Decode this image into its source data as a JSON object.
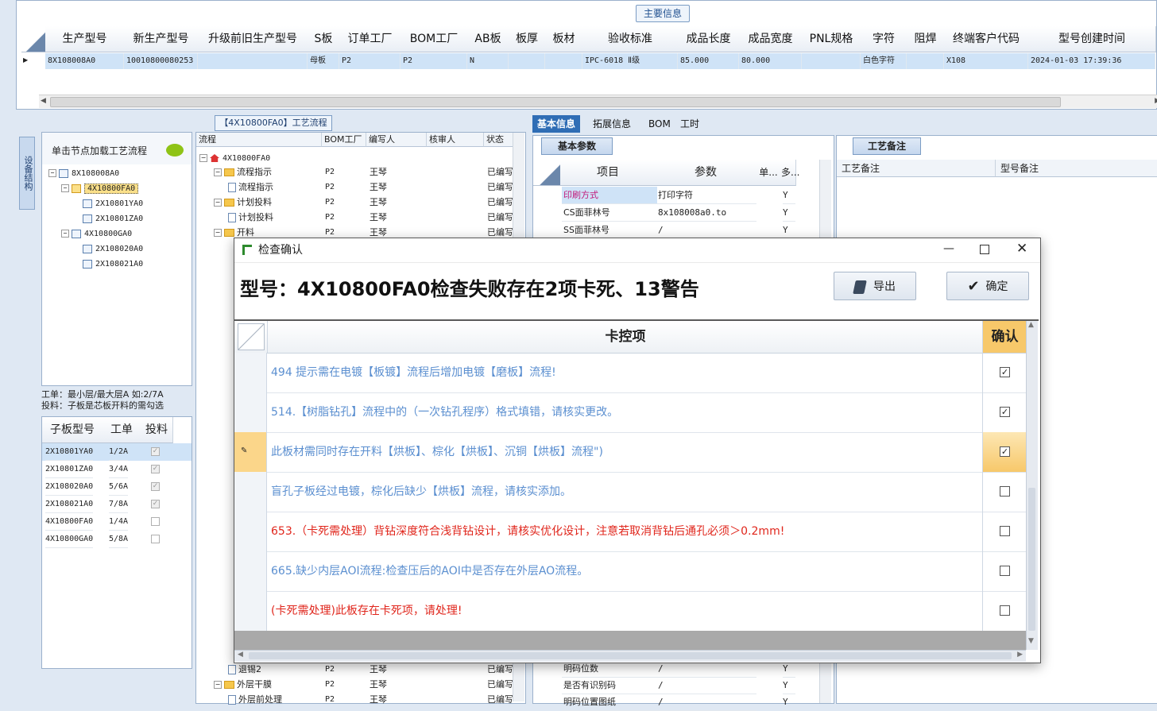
{
  "top": {
    "tab_label": "主要信息",
    "columns": [
      "生产型号",
      "新生产型号",
      "升级前旧生产型号",
      "S板",
      "订单工厂",
      "BOM工厂",
      "AB板",
      "板厚",
      "板材",
      "验收标准",
      "成品长度",
      "成品宽度",
      "PNL规格",
      "字符",
      "阻焊",
      "终端客户代码",
      "型号创建时间"
    ],
    "row": [
      "8X108008A0",
      "10010800080253",
      "",
      "母板",
      "P2",
      "P2",
      "N",
      "",
      "",
      "IPC-6018 Ⅱ级",
      "85.000",
      "80.000",
      "",
      "白色字符",
      "",
      "X108",
      "2024-01-03 17:39:36"
    ]
  },
  "left": {
    "vtab_label": "设备结构",
    "tree_hint": "单击节点加载工艺流程",
    "tree": [
      {
        "label": "8X108008A0",
        "level": 0
      },
      {
        "label": "4X10800FA0",
        "level": 1,
        "selected": true
      },
      {
        "label": "2X10801YA0",
        "level": 2
      },
      {
        "label": "2X10801ZA0",
        "level": 2
      },
      {
        "label": "4X10800GA0",
        "level": 1
      },
      {
        "label": "2X108020A0",
        "level": 2
      },
      {
        "label": "2X108021A0",
        "level": 2
      }
    ],
    "note_line1": "工单：最小层/最大层A 如:2/7A",
    "note_line2": "投料：子板是芯板开料的需勾选",
    "sub_columns": [
      "子板型号",
      "工单",
      "投料"
    ],
    "sub_rows": [
      {
        "model": "2X10801YA0",
        "order": "1/2A",
        "checked": true
      },
      {
        "model": "2X10801ZA0",
        "order": "3/4A",
        "checked": true
      },
      {
        "model": "2X108020A0",
        "order": "5/6A",
        "checked": true
      },
      {
        "model": "2X108021A0",
        "order": "7/8A",
        "checked": true
      },
      {
        "model": "4X10800FA0",
        "order": "1/4A",
        "checked": false
      },
      {
        "model": "4X10800GA0",
        "order": "5/8A",
        "checked": false
      }
    ]
  },
  "flow": {
    "tab_label": "【4X10800FA0】工艺流程",
    "columns": [
      "流程",
      "BOM工厂",
      "编写人",
      "核审人",
      "状态"
    ],
    "root": "4X10800FA0",
    "rows": [
      {
        "name": "流程指示",
        "type": "folder",
        "factory": "P2",
        "writer": "王琴",
        "status": "已编写"
      },
      {
        "name": "流程指示",
        "type": "doc",
        "factory": "P2",
        "writer": "王琴",
        "status": "已编写"
      },
      {
        "name": "计划投料",
        "type": "folder",
        "factory": "P2",
        "writer": "王琴",
        "status": "已编写"
      },
      {
        "name": "计划投料",
        "type": "doc",
        "factory": "P2",
        "writer": "王琴",
        "status": "已编写"
      },
      {
        "name": "开料",
        "type": "folder",
        "factory": "P2",
        "writer": "王琴",
        "status": "已编写"
      }
    ],
    "bottom_rows": [
      {
        "name": "退锡2",
        "type": "doc",
        "factory": "P2",
        "writer": "王琴",
        "status": "已编写"
      },
      {
        "name": "外层干膜",
        "type": "folder",
        "factory": "P2",
        "writer": "王琴",
        "status": "已编写"
      },
      {
        "name": "外层前处理",
        "type": "doc",
        "factory": "P2",
        "writer": "王琴",
        "status": "已编写"
      }
    ]
  },
  "right": {
    "tabs": [
      "基本信息",
      "拓展信息",
      "BOM",
      "工时"
    ],
    "basic_sub_tab": "基本参数",
    "basic_columns": [
      "项目",
      "参数",
      "单...",
      "多..."
    ],
    "basic_rows": [
      {
        "item": "印刷方式",
        "param": "打印字符",
        "multi": "Y",
        "highlight": true
      },
      {
        "item": "CS面菲林号",
        "param": "8x108008a0.to",
        "multi": "Y"
      },
      {
        "item": "SS面菲林号",
        "param": "/",
        "multi": "Y"
      }
    ],
    "basic_bottom_rows": [
      {
        "item": "明码位数",
        "param": "/",
        "multi": "Y"
      },
      {
        "item": "是否有识别码",
        "param": "/",
        "multi": "Y"
      },
      {
        "item": "明码位置图纸",
        "param": "/",
        "multi": "Y"
      }
    ],
    "remark_tab": "工艺备注",
    "remark_col1": "工艺备注",
    "remark_col2": "型号备注"
  },
  "dialog": {
    "title": "检查确认",
    "heading": "型号：4X10800FA0检查失败存在2项卡死、13警告",
    "export_label": "导出",
    "confirm_label": "确定",
    "col_item": "卡控项",
    "col_confirm": "确认",
    "colors": {
      "warning": "#5b8fd0",
      "fatal": "#e0261c"
    },
    "items": [
      {
        "text": "494 提示需在电镀【板镀】流程后增加电镀【磨板】流程!",
        "level": "warning",
        "checked": true
      },
      {
        "text": "514.【树脂钻孔】流程中的（一次钻孔程序）格式填错，请核实更改。",
        "level": "warning",
        "checked": true
      },
      {
        "text": "此板材需同时存在开料【烘板】、棕化【烘板】、沉铜【烘板】流程\")",
        "level": "warning",
        "checked": true,
        "selected": true
      },
      {
        "text": "盲孔子板经过电镀，棕化后缺少【烘板】流程，请核实添加。",
        "level": "warning",
        "checked": false
      },
      {
        "text": "653.（卡死需处理）背钻深度符合浅背钻设计，请核实优化设计，注意若取消背钻后通孔必须＞0.2mm!",
        "level": "fatal",
        "checked": false
      },
      {
        "text": "665.缺少内层AOI流程:检查压后的AOI中是否存在外层AO流程。",
        "level": "warning",
        "checked": false
      },
      {
        "text": "(卡死需处理)此板存在卡死项，请处理!",
        "level": "fatal",
        "checked": false
      }
    ]
  }
}
